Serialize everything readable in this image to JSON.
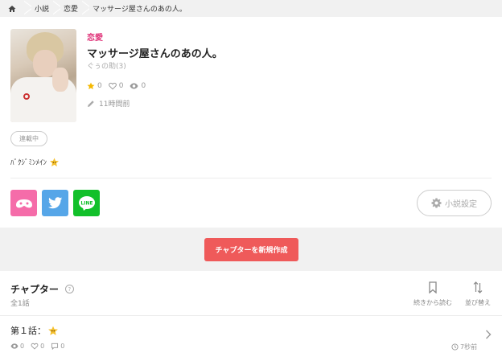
{
  "breadcrumb": {
    "items": [
      "小説",
      "恋愛",
      "マッサージ屋さんのあの人。"
    ]
  },
  "novel": {
    "genre": "恋愛",
    "title": "マッサージ屋さんのあの人。",
    "author": "ぐぅの助(3)",
    "stars": "0",
    "likes": "0",
    "views": "0",
    "updated": "11時間前",
    "status": "連載中",
    "description": "ﾊﾞｸｼﾞﾐﾝﾒｲﾝ"
  },
  "share": {
    "line_label": "LINE"
  },
  "settings": {
    "label": "小説設定"
  },
  "new_chapter": {
    "label": "チャプターを新規作成"
  },
  "chapters": {
    "heading": "チャプター",
    "help": "?",
    "count": "全1話",
    "resume_label": "続きから読む",
    "sort_label": "並び替え",
    "items": [
      {
        "title": "第１話：",
        "views": "0",
        "likes": "0",
        "comments": "0",
        "time": "7秒前"
      }
    ]
  },
  "colors": {
    "accent": "#e0357a",
    "primary_button": "#ef5a5a",
    "twitter": "#56a6e8",
    "line": "#12c02a",
    "app": "#f56ca9",
    "star": "#f5b800"
  },
  "icons": [
    "home-icon",
    "star-icon",
    "heart-icon",
    "eye-icon",
    "pencil-icon",
    "gear-icon",
    "bookmark-icon",
    "sort-icon",
    "comment-icon",
    "clock-icon",
    "chevron-right-icon",
    "twitter-icon",
    "line-icon",
    "app-logo-icon",
    "star-emoji-icon"
  ]
}
